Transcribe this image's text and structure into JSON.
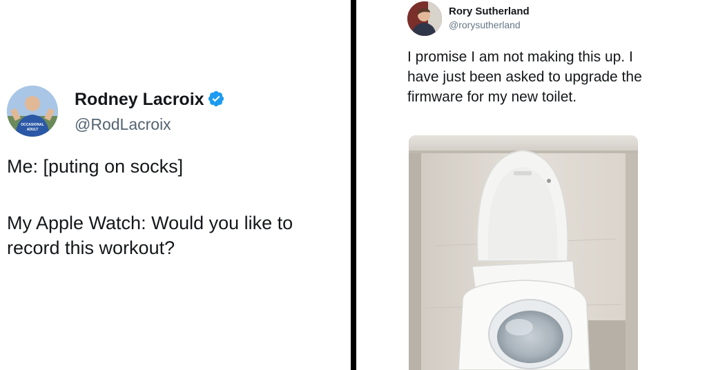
{
  "left_tweet": {
    "author_name": "Rodney Lacroix",
    "author_handle": "@RodLacroix",
    "line1": "Me: [puting on socks]",
    "line2": "My Apple Watch: Would you like to record this workout?",
    "avatar_shirt_text": "OCCASIONAL ADULT",
    "verified_color": "#1d9bf0"
  },
  "right_tweet": {
    "author_name": "Rory Sutherland",
    "author_handle": "@rorysutherland",
    "body": "I promise I am not making this up. I have just been asked to upgrade the firmware for my new toilet.",
    "photo_subject": "toilet"
  }
}
